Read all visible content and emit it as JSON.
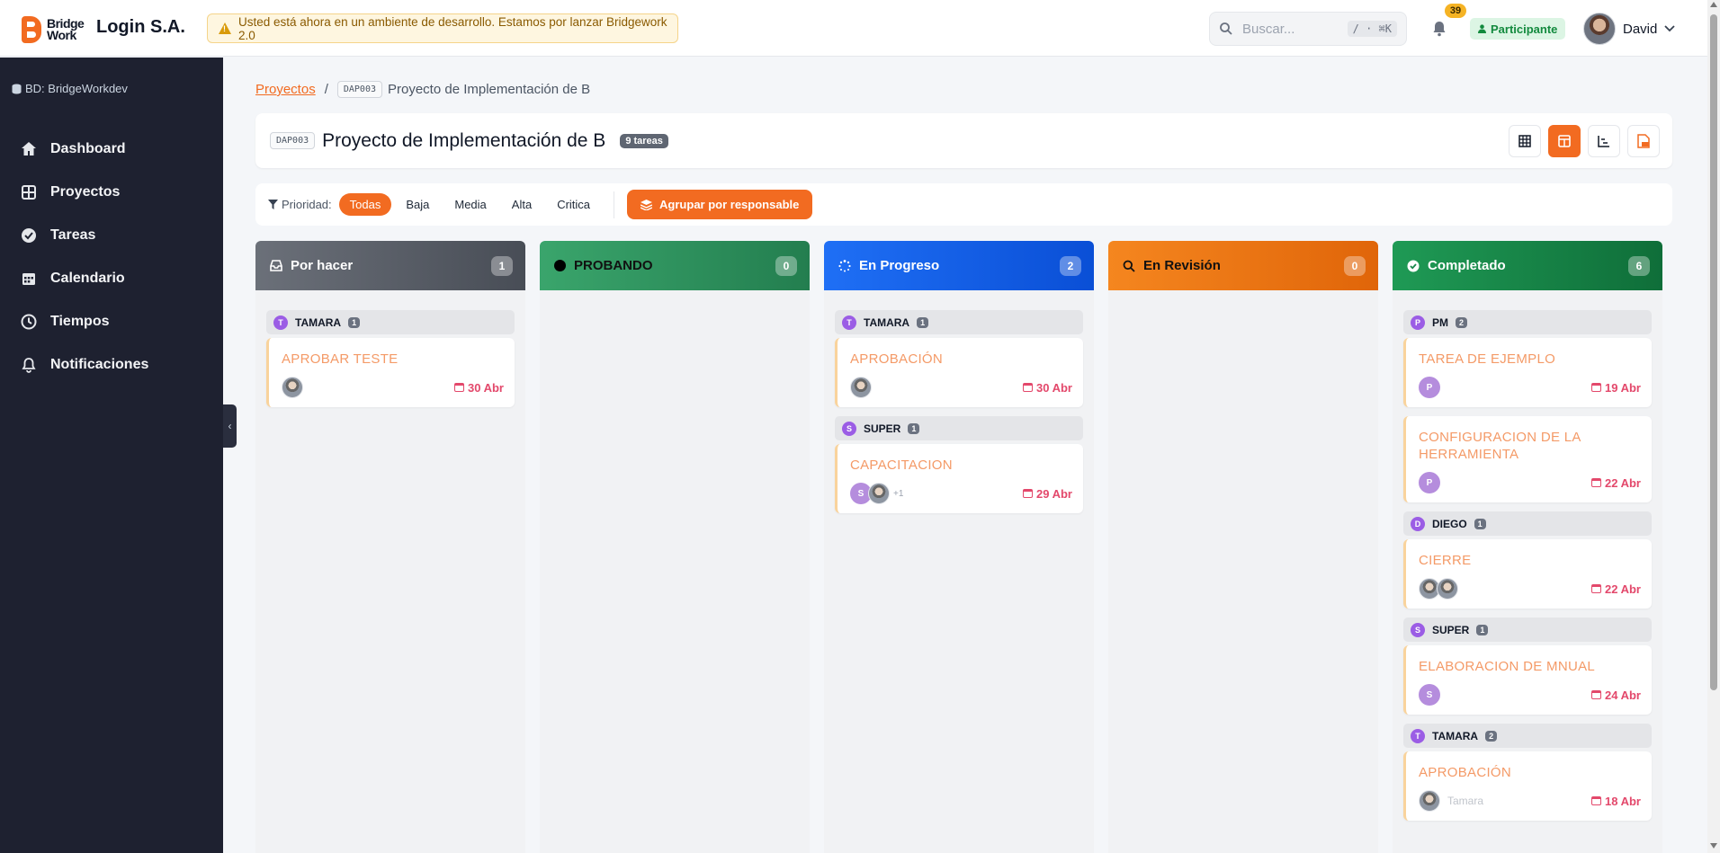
{
  "header": {
    "logo_line1": "Bridge",
    "logo_line2": "Work",
    "company": "Login S.A.",
    "dev_warning": "Usted está ahora en un ambiente de desarrollo. Estamos por lanzar Bridgework 2.0",
    "search_placeholder": "Buscar...",
    "search_shortcut": "/ · ⌘K",
    "notifications_count": "39",
    "role": "Participante",
    "user_name": "David"
  },
  "sidebar": {
    "db_label": "BD: BridgeWorkdev",
    "items": [
      {
        "label": "Dashboard",
        "icon": "home-icon"
      },
      {
        "label": "Proyectos",
        "icon": "grid-icon"
      },
      {
        "label": "Tareas",
        "icon": "check-circle-icon"
      },
      {
        "label": "Calendario",
        "icon": "calendar-icon"
      },
      {
        "label": "Tiempos",
        "icon": "clock-icon"
      },
      {
        "label": "Notificaciones",
        "icon": "bell-icon"
      }
    ]
  },
  "breadcrumb": {
    "root": "Proyectos",
    "separator": "/",
    "code": "DAP003",
    "current": "Proyecto de Implementación de B"
  },
  "project": {
    "code": "DAP003",
    "title": "Proyecto de Implementación de B",
    "task_count": "9 tareas"
  },
  "filters": {
    "label": "Prioridad:",
    "options": [
      "Todas",
      "Baja",
      "Media",
      "Alta",
      "Critica"
    ],
    "selected": "Todas",
    "group_button": "Agrupar por responsable"
  },
  "columns": [
    {
      "title": "Por hacer",
      "count": "1",
      "color": "#5a5f68",
      "groups": [
        {
          "initial": "T",
          "name": "TAMARA",
          "count": "1",
          "cards": [
            {
              "title": "APROBAR TESTE",
              "date": "30 Abr",
              "avatars": [
                "photo"
              ]
            }
          ]
        }
      ]
    },
    {
      "title": "PROBANDO",
      "count": "0",
      "color": "#2f9e63",
      "groups": []
    },
    {
      "title": "En Progreso",
      "count": "2",
      "color": "#1266f1",
      "groups": [
        {
          "initial": "T",
          "name": "TAMARA",
          "count": "1",
          "cards": [
            {
              "title": "APROBACIÓN",
              "date": "30 Abr",
              "avatars": [
                "photo"
              ]
            }
          ]
        },
        {
          "initial": "S",
          "name": "SUPER",
          "count": "1",
          "cards": [
            {
              "title": "CAPACITACION",
              "date": "29 Abr",
              "avatars": [
                "S",
                "photo"
              ],
              "extra": "+1"
            }
          ]
        }
      ]
    },
    {
      "title": "En Revisión",
      "count": "0",
      "color": "#f07a17",
      "groups": []
    },
    {
      "title": "Completado",
      "count": "6",
      "color": "#17874a",
      "groups": [
        {
          "initial": "P",
          "name": "PM",
          "count": "2",
          "cards": [
            {
              "title": "TAREA DE EJEMPLO",
              "date": "19 Abr",
              "avatars": [
                "P"
              ]
            },
            {
              "title": "CONFIGURACION DE LA HERRAMIENTA",
              "date": "22 Abr",
              "avatars": [
                "P"
              ]
            }
          ]
        },
        {
          "initial": "D",
          "name": "DIEGO",
          "count": "1",
          "cards": [
            {
              "title": "CIERRE",
              "date": "22 Abr",
              "avatars": [
                "photo",
                "photo"
              ]
            }
          ]
        },
        {
          "initial": "S",
          "name": "SUPER",
          "count": "1",
          "cards": [
            {
              "title": "ELABORACION DE MNUAL",
              "date": "24 Abr",
              "avatars": [
                "S"
              ]
            }
          ]
        },
        {
          "initial": "T",
          "name": "TAMARA",
          "count": "2",
          "cards": [
            {
              "title": "APROBACIÓN",
              "date": "18 Abr",
              "avatars": [
                "photo"
              ],
              "assignee": "Tamara"
            }
          ]
        }
      ]
    }
  ],
  "colors": {
    "accent": "#f26b21",
    "sidebar": "#1e2130",
    "date": "#e3486b"
  }
}
